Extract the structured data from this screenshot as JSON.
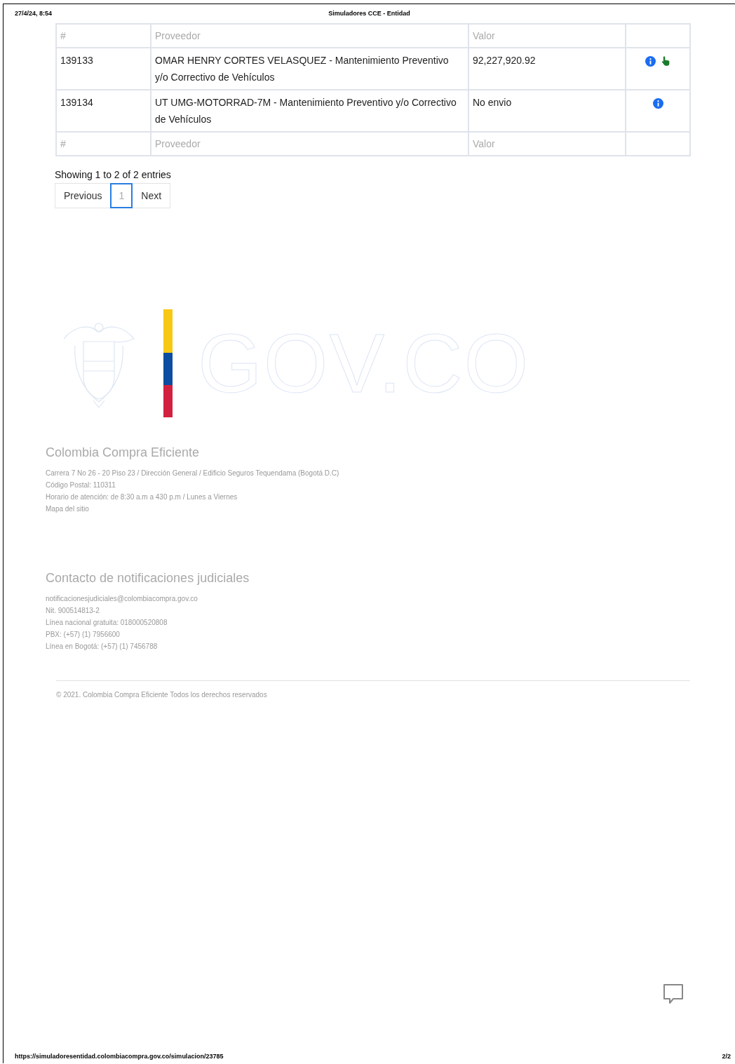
{
  "print_header": {
    "date": "27/4/24, 8:54",
    "title": "Simuladores CCE - Entidad"
  },
  "table": {
    "columns": [
      "#",
      "Proveedor",
      "Valor"
    ],
    "rows": [
      {
        "id": "139133",
        "provider": "OMAR HENRY CORTES VELASQUEZ - Mantenimiento Preventivo y/o Correctivo de Vehículos",
        "value": "92,227,920.92",
        "actions": [
          {
            "kind": "info"
          },
          {
            "kind": "select"
          }
        ]
      },
      {
        "id": "139134",
        "provider": "UT UMG-MOTORRAD-7M - Mantenimiento Preventivo y/o Correctivo de Vehículos",
        "value": "No envio",
        "actions": [
          {
            "kind": "info"
          }
        ]
      }
    ],
    "footer_columns": [
      "#",
      "Proveedor",
      "Valor"
    ]
  },
  "summary": "Showing 1 to 2 of 2 entries",
  "pagination": [
    {
      "label": "Previous",
      "selected": false
    },
    {
      "label": "1",
      "selected": true
    },
    {
      "label": "Next",
      "selected": false
    }
  ],
  "logo": {
    "text": "GOV.CO"
  },
  "footer": {
    "title": "Colombia Compra Eficiente",
    "lines": [
      "Carrera 7 No 26 - 20 Piso 23 / Dirección General / Edificio Seguros Tequendama (Bogotá D.C)",
      "Código Postal: 110311",
      "Horario de atención: de 8:30 a.m a 430 p.m / Lunes a Viernes"
    ],
    "sitemap_link": "Mapa del sitio",
    "contact_title": "Contacto de notificaciones judiciales",
    "contact_lines": [
      "notificacionesjudiciales@colombiacompra.gov.co",
      "Nit. 900514813-2",
      "Línea nacional gratuita: 018000520808",
      "PBX: (+57) (1) 7956600",
      "Línea en Bogotá: (+57) (1) 7456788"
    ],
    "copyright": "© 2021. Colombia Compra Eficiente Todos los derechos reservados"
  },
  "print_footer": {
    "url": "https://simuladoresentidad.colombiacompra.gov.co/simulacion/23785",
    "page": "2/2"
  }
}
